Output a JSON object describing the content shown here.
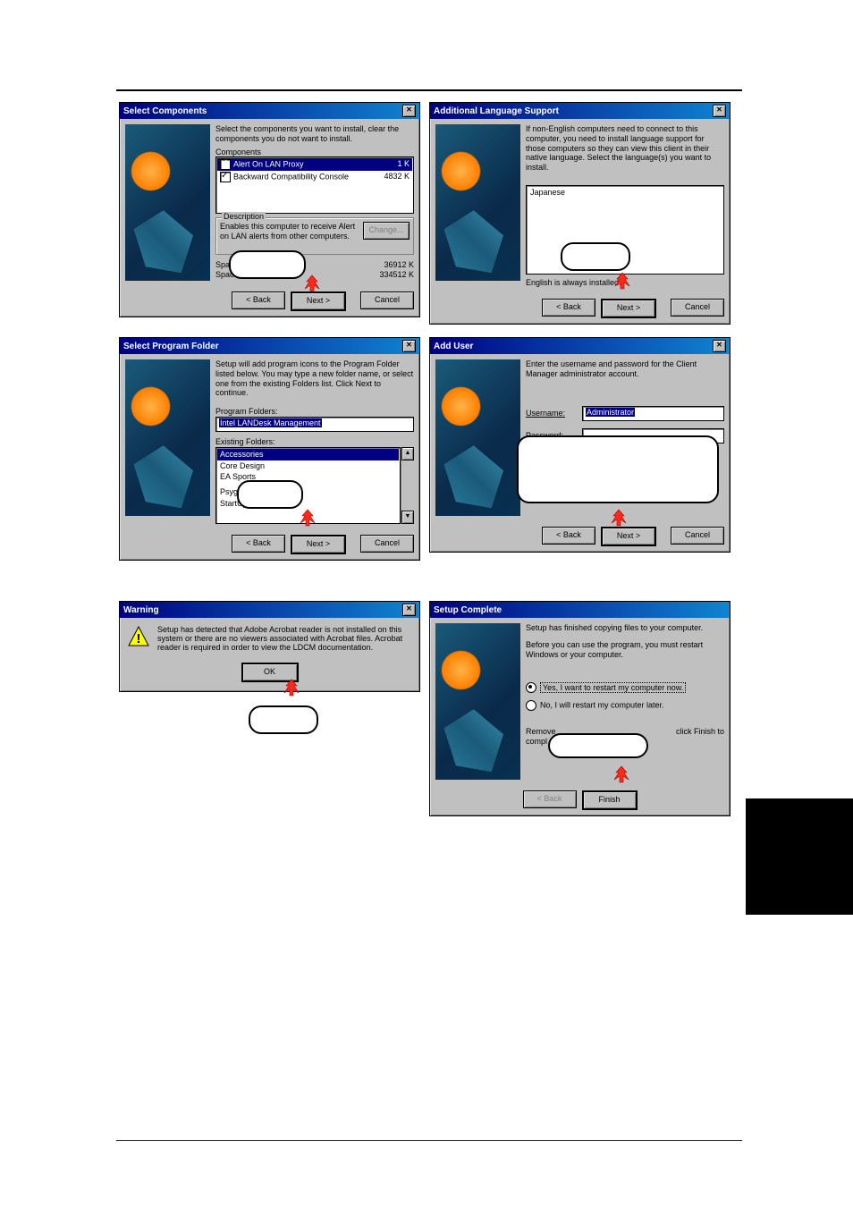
{
  "d1": {
    "title": "Select Components",
    "instr": "Select the components you want to install, clear the components you do not want to install.",
    "lbl_comp": "Components",
    "c1": "Alert On LAN Proxy",
    "c1k": "1 K",
    "c2": "Backward Compatibility Console",
    "c2k": "4832 K",
    "desc_legend": "Description",
    "desc": "Enables this computer to receive Alert on LAN alerts from other computers.",
    "change": "Change...",
    "spreq": "Space Required:",
    "spreqv": "36912 K",
    "spav": "Space Available:",
    "spavv": "334512 K",
    "back": "< Back",
    "next": "Next >",
    "cancel": "Cancel"
  },
  "d2": {
    "title": "Additional Language Support",
    "instr": "If non-English computers need to connect to this computer, you need to install language support for those computers so they can view this client in their native language. Select the language(s) you want to install.",
    "lang": "Japanese",
    "note": "English is always installed.",
    "back": "< Back",
    "next": "Next >",
    "cancel": "Cancel"
  },
  "d3": {
    "title": "Select Program Folder",
    "instr": "Setup will add program icons to the Program Folder listed below. You may type a new folder name, or select one from the existing Folders list. Click Next to continue.",
    "lbl_pf": "Program Folders:",
    "pfv": "Intel LANDesk Management",
    "lbl_ef": "Existing Folders:",
    "ef": [
      "Accessories",
      "Core Design",
      "EA Sports",
      "",
      "",
      "Psygnosis",
      "StartUp"
    ],
    "back": "< Back",
    "next": "Next >",
    "cancel": "Cancel"
  },
  "d4": {
    "title": "Add User",
    "instr": "Enter the username and password for the Client Manager administrator account.",
    "lbl_u": "Username:",
    "uv": "Administrator",
    "lbl_p": "Password:",
    "back": "< Back",
    "next": "Next >",
    "cancel": "Cancel"
  },
  "d5": {
    "title": "Warning",
    "msg": "Setup has detected that Adobe Acrobat reader is not installed on this system or there are no viewers associated with Acrobat files. Acrobat reader is required in order to view the LDCM documentation.",
    "ok": "OK"
  },
  "d6": {
    "title": "Setup Complete",
    "l1": "Setup has finished copying files to your computer.",
    "l2": "Before you can use the program, you must restart Windows or your computer.",
    "r1": "Yes, I want to restart my computer now.",
    "r2": "No, I will restart my computer later.",
    "l3a": "Remove",
    "l3b": "click Finish to",
    "l3c": "compl",
    "back": "< Back",
    "finish": "Finish"
  }
}
